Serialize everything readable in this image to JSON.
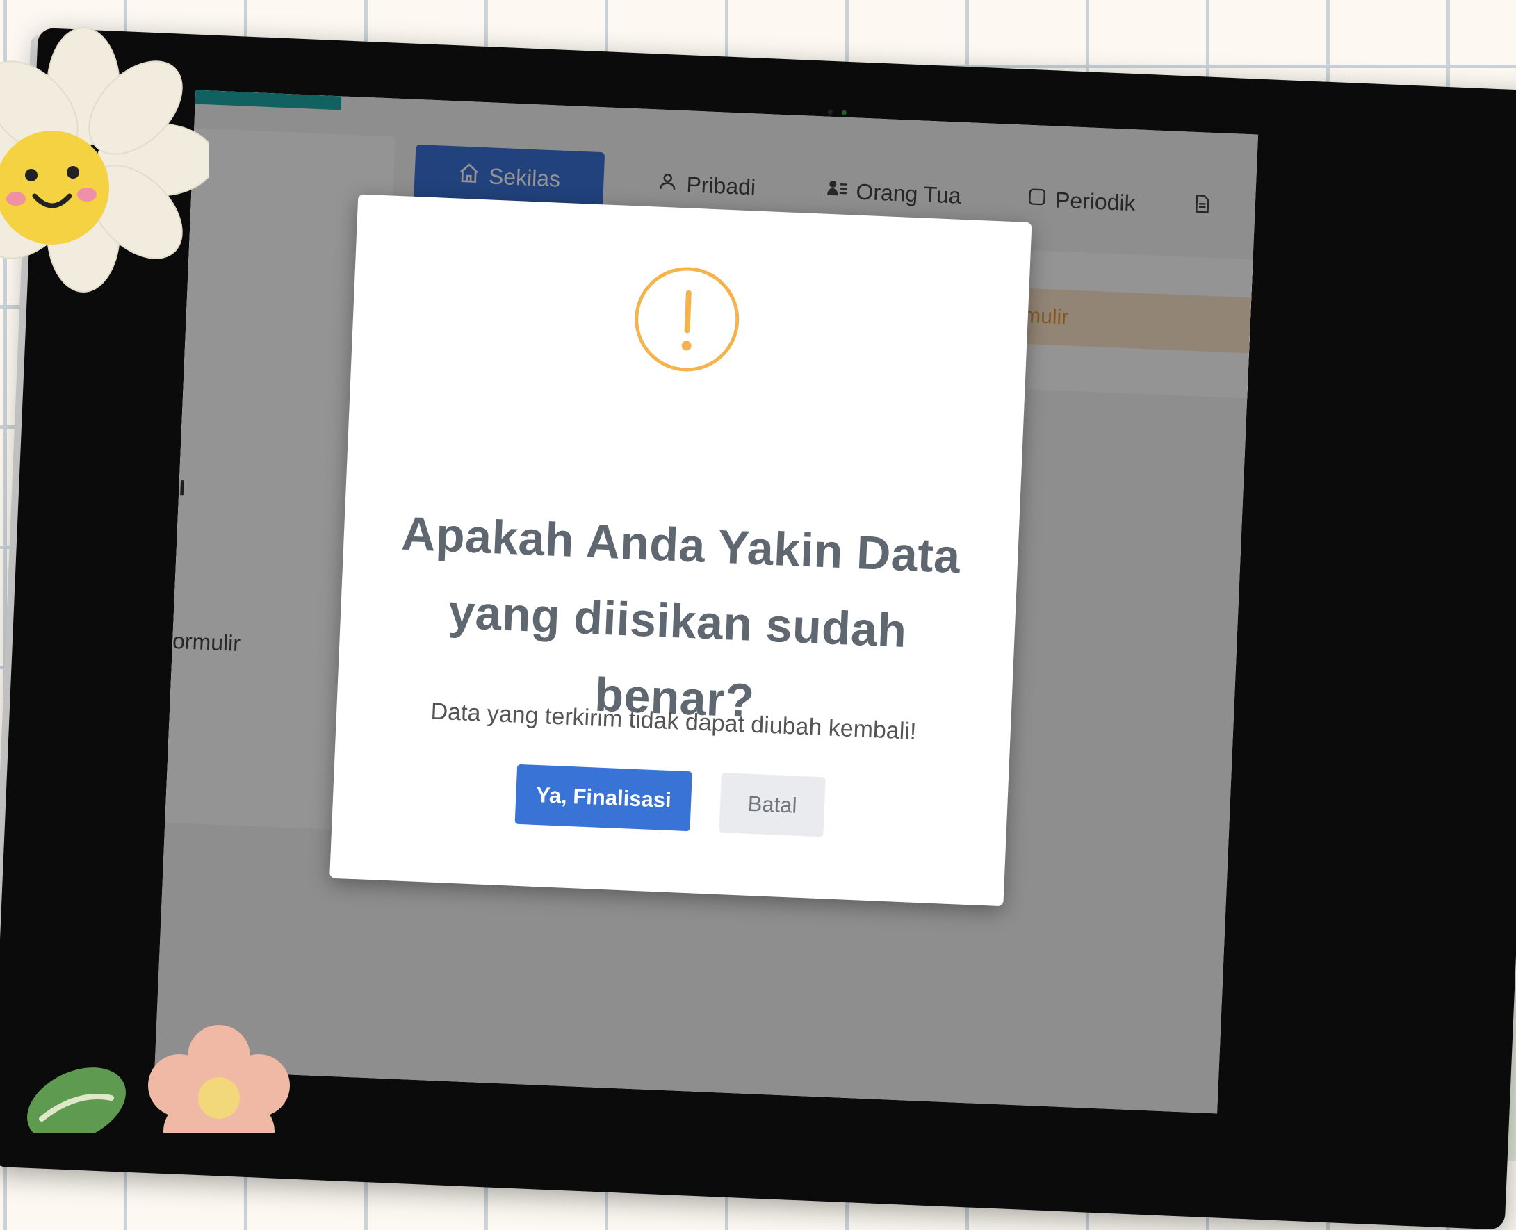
{
  "tabs": [
    {
      "label": "Sekilas",
      "icon": "home-icon",
      "active": true
    },
    {
      "label": "Pribadi",
      "icon": "user-icon",
      "active": false
    },
    {
      "label": "Orang Tua",
      "icon": "parents-icon",
      "active": false
    },
    {
      "label": "Periodik",
      "icon": "square-icon",
      "active": false
    },
    {
      "label": "",
      "icon": "document-icon",
      "active": false
    }
  ],
  "banner": {
    "text": "isasi formulir"
  },
  "left_panel": {
    "fragment_1": "I",
    "fragment_2": "ormulir"
  },
  "modal": {
    "title": "Apakah Anda Yakin Data yang diisikan sudah benar?",
    "text": "Data yang terkirim tidak dapat diubah kembali!",
    "confirm_label": "Ya, Finalisasi",
    "cancel_label": "Batal"
  },
  "colors": {
    "primary": "#3a73d6",
    "warning": "#f5b34c",
    "teal_accent": "#20a8a8",
    "warning_banner_bg": "#fbe6cb",
    "cancel_bg": "#e9ebef"
  }
}
